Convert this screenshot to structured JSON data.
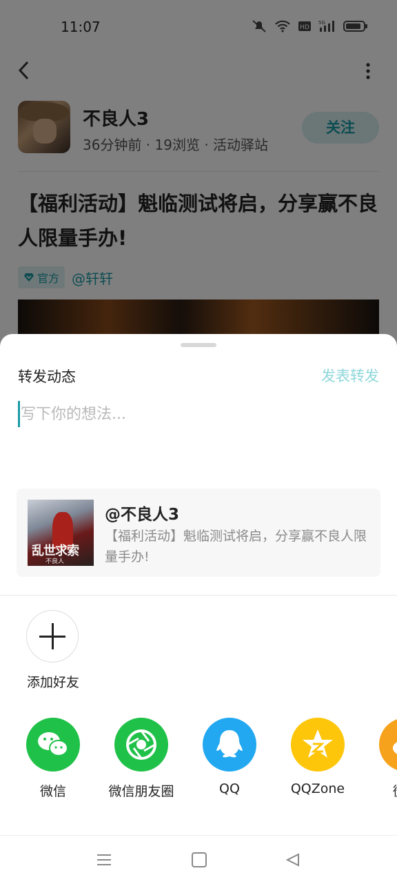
{
  "status_bar": {
    "time": "11:07"
  },
  "author": {
    "name": "不良人3",
    "meta": "36分钟前 · 19浏览 · 活动驿站",
    "follow_label": "关注"
  },
  "post": {
    "title": "【福利活动】魁临测试将启，分享赢不良人限量手办!",
    "official_tag": "官方",
    "mention": "@轩轩"
  },
  "repost_sheet": {
    "title": "转发动态",
    "publish_label": "发表转发",
    "input_placeholder": "写下你的想法...",
    "quote": {
      "name": "@不良人3",
      "text": "【福利活动】魁临测试将启，分享赢不良人限量手办!",
      "thumb_logo": "乱世求索",
      "thumb_sub": "不良人"
    },
    "add_friend_label": "添加好友",
    "share_targets": [
      {
        "label": "微信",
        "icon": "wechat-icon",
        "color": "#20c149"
      },
      {
        "label": "微信朋友圈",
        "icon": "moments-icon",
        "color": "#20c149"
      },
      {
        "label": "QQ",
        "icon": "qq-icon",
        "color": "#22a8f0"
      },
      {
        "label": "QQZone",
        "icon": "qzone-icon",
        "color": "#fec60a"
      },
      {
        "label": "微博",
        "icon": "weibo-icon",
        "color": "#f6a21c"
      }
    ]
  }
}
